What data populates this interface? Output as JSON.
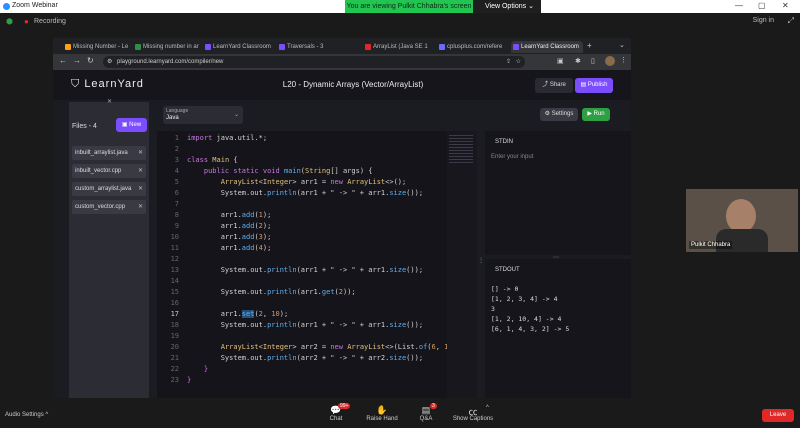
{
  "zoom": {
    "window_title": "Zoom Webinar",
    "share_banner": "You are viewing Pulkit Chhabra's screen",
    "view_options": "View Options",
    "recording": "Recording",
    "sign_in": "Sign in"
  },
  "browser": {
    "tabs": [
      {
        "label": "Missing Number - Le"
      },
      {
        "label": "Missing number in ar"
      },
      {
        "label": "LearnYard Classroom"
      },
      {
        "label": "Traversals - 3"
      },
      {
        "label": "ArrayList (Java SE 1"
      },
      {
        "label": "cplusplus.com/refere"
      },
      {
        "label": "LearnYard Classroom"
      }
    ],
    "new_tab": "+",
    "url": "playground.learnyard.com/compiler/new"
  },
  "app": {
    "logo": "LearnYard",
    "title": "L20 - Dynamic Arrays (Vector/ArrayList)",
    "share_label": "Share",
    "publish_label": "Publish",
    "files_title": "Files - 4",
    "new_label": "New",
    "files": [
      {
        "name": "inbuilt_arraylist.java"
      },
      {
        "name": "inbuilt_vector.cpp"
      },
      {
        "name": "custom_arraylist.java"
      },
      {
        "name": "custom_vector.cpp"
      }
    ],
    "language_label": "Language",
    "language_value": "Java",
    "settings_label": "Settings",
    "run_label": "Run",
    "stdin_title": "STDIN",
    "stdin_placeholder": "Enter your input",
    "stdout_title": "STDOUT",
    "stdout": "[] -> 0\n[1, 2, 3, 4] -> 4\n3\n[1, 2, 10, 4] -> 4\n[6, 1, 4, 3, 2] -> 5"
  },
  "code": {
    "line_numbers": [
      "1",
      "2",
      "3",
      "4",
      "5",
      "6",
      "7",
      "8",
      "9",
      "10",
      "11",
      "12",
      "13",
      "14",
      "15",
      "16",
      "17",
      "18",
      "19",
      "20",
      "21",
      "22",
      "23"
    ],
    "current_line": "17"
  },
  "video": {
    "name": "Pulkit Chhabra"
  },
  "bottom_bar": {
    "audio_settings": "Audio Settings",
    "chat": "Chat",
    "chat_badge": "99+",
    "raise_hand": "Raise Hand",
    "qa": "Q&A",
    "qa_badge": "3",
    "captions": "Show Captions",
    "leave": "Leave"
  }
}
